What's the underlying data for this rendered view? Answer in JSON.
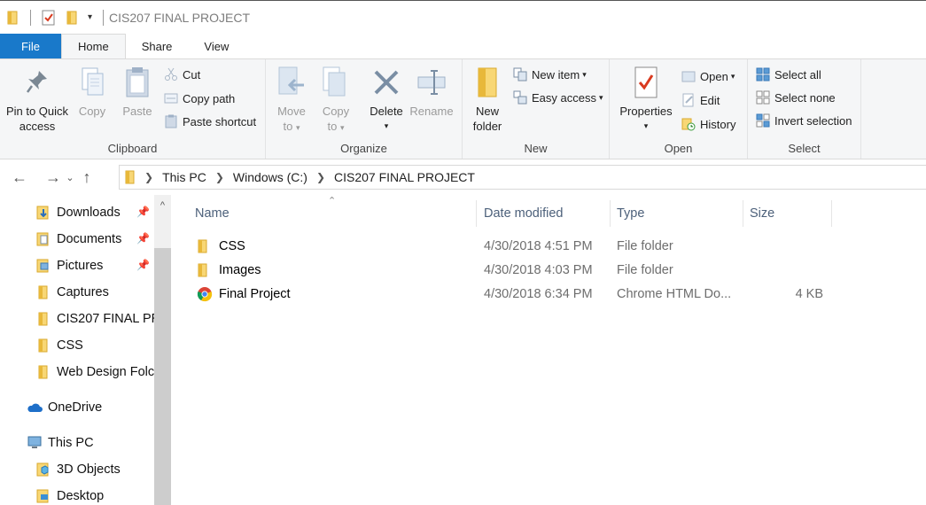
{
  "window": {
    "title": "CIS207 FINAL PROJECT"
  },
  "tabs": [
    {
      "label": "File"
    },
    {
      "label": "Home"
    },
    {
      "label": "Share"
    },
    {
      "label": "View"
    }
  ],
  "ribbon": {
    "clipboard": {
      "label": "Clipboard",
      "pin_quick_access": "Pin to Quick access",
      "copy": "Copy",
      "paste": "Paste",
      "cut": "Cut",
      "copy_path": "Copy path",
      "paste_shortcut": "Paste shortcut"
    },
    "organize": {
      "label": "Organize",
      "move_to": "Move to",
      "copy_to": "Copy to",
      "delete": "Delete",
      "rename": "Rename"
    },
    "new": {
      "label": "New",
      "new_folder": "New folder",
      "new_item": "New item",
      "easy_access": "Easy access"
    },
    "open": {
      "label": "Open",
      "properties": "Properties",
      "open": "Open",
      "edit": "Edit",
      "history": "History"
    },
    "select": {
      "label": "Select",
      "select_all": "Select all",
      "select_none": "Select none",
      "invert_selection": "Invert selection"
    }
  },
  "address": {
    "crumbs": [
      "This PC",
      "Windows (C:)",
      "CIS207 FINAL PROJECT"
    ]
  },
  "sidebar": {
    "items": [
      {
        "label": "Downloads",
        "icon": "downloads-folder-icon",
        "pinned": true
      },
      {
        "label": "Documents",
        "icon": "documents-folder-icon",
        "pinned": true
      },
      {
        "label": "Pictures",
        "icon": "pictures-folder-icon",
        "pinned": true
      },
      {
        "label": "Captures",
        "icon": "folder-icon",
        "pinned": false
      },
      {
        "label": "CIS207 FINAL PR",
        "icon": "folder-icon",
        "pinned": false
      },
      {
        "label": "CSS",
        "icon": "folder-icon",
        "pinned": false
      },
      {
        "label": "Web Design Folc",
        "icon": "folder-icon",
        "pinned": false
      },
      {
        "label": "OneDrive",
        "icon": "onedrive-icon",
        "pinned": false
      },
      {
        "label": "This PC",
        "icon": "this-pc-icon",
        "pinned": false
      },
      {
        "label": "3D Objects",
        "icon": "3d-objects-icon",
        "pinned": false
      },
      {
        "label": "Desktop",
        "icon": "desktop-folder-icon",
        "pinned": false
      }
    ]
  },
  "file_list": {
    "columns": [
      "Name",
      "Date modified",
      "Type",
      "Size"
    ],
    "rows": [
      {
        "name": "CSS",
        "date": "4/30/2018 4:51 PM",
        "type": "File folder",
        "size": "",
        "icon": "folder-icon"
      },
      {
        "name": "Images",
        "date": "4/30/2018 4:03 PM",
        "type": "File folder",
        "size": "",
        "icon": "folder-icon"
      },
      {
        "name": "Final Project",
        "date": "4/30/2018 6:34 PM",
        "type": "Chrome HTML Do...",
        "size": "4 KB",
        "icon": "chrome-icon"
      }
    ]
  },
  "colors": {
    "accent": "#1979ca",
    "folder": "#f8d775",
    "folder_dark": "#e8b83a"
  }
}
